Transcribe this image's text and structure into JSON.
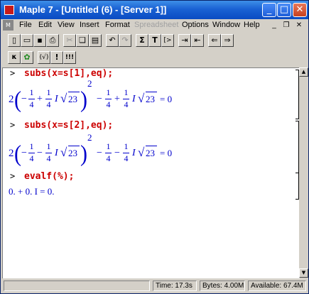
{
  "window": {
    "title": "Maple 7 - [Untitled (6) - [Server 1]]"
  },
  "menu": [
    "File",
    "Edit",
    "View",
    "Insert",
    "Format",
    "Spreadsheet",
    "Options",
    "Window",
    "Help"
  ],
  "toolbar1": [
    "new",
    "open",
    "save",
    "print",
    "cut",
    "copy",
    "paste",
    "undo",
    "redo",
    "Σ",
    "T",
    "[>",
    "indent",
    "outdent",
    "back",
    "forward"
  ],
  "toolbar2": [
    "κ",
    "maple-leaf",
    "(√)",
    "!",
    "!!!"
  ],
  "worksheet": {
    "prompt": ">",
    "cmd1": "subs(x=s[1],eq);",
    "cmd2": "subs(x=s[2],eq);",
    "cmd3": "evalf(%);",
    "out3": "0. + 0. I = 0.",
    "eq_sign": "= 0",
    "two": "2",
    "one": "1",
    "four": "4",
    "I": "I",
    "n23": "23"
  },
  "status": {
    "time": "Time: 17.3s",
    "bytes": "Bytes: 4.00M",
    "available": "Available: 67.4M"
  }
}
